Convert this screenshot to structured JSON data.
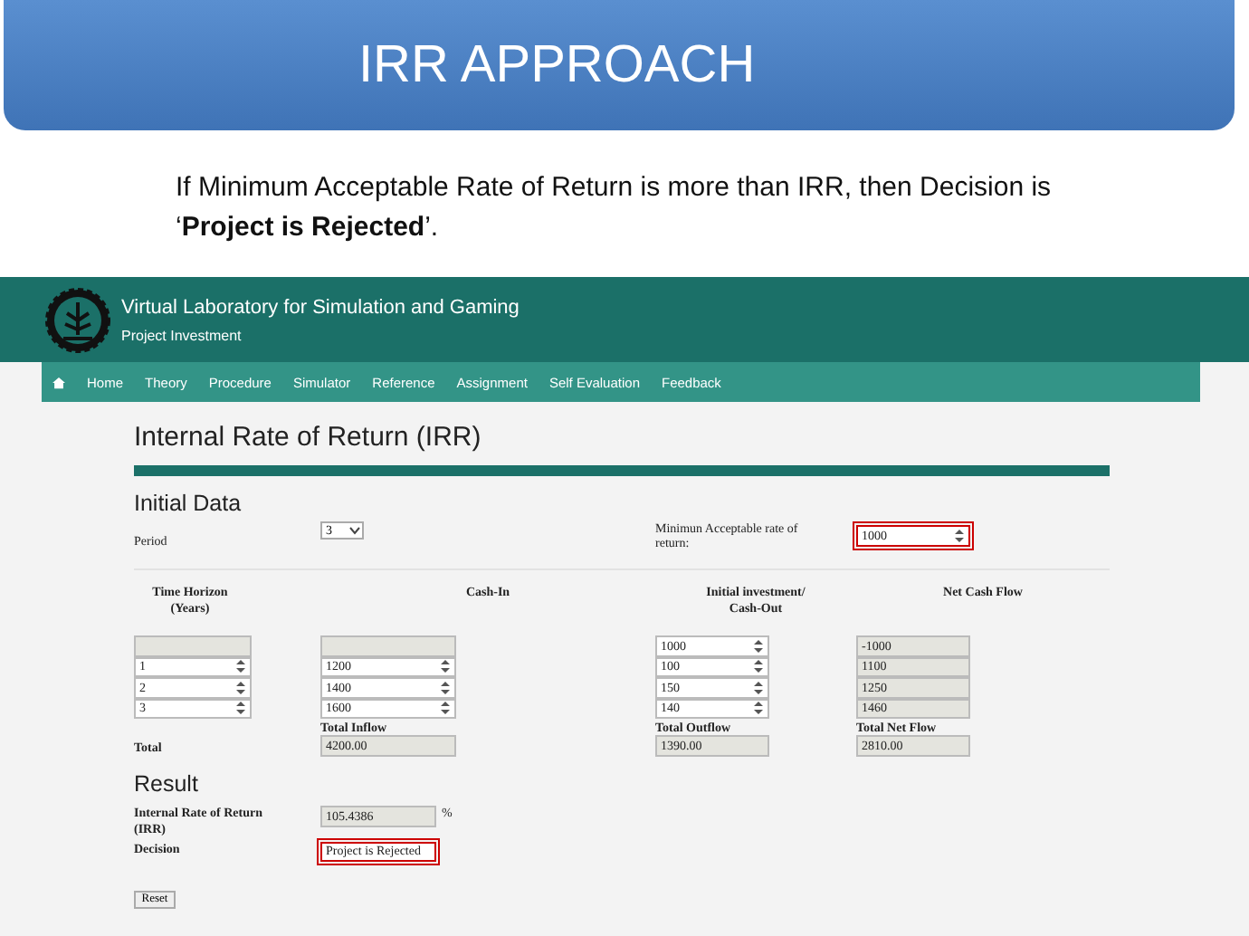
{
  "slide": {
    "title": "IRR APPROACH",
    "note": "If Minimum Acceptable Rate of Return is more than IRR, then Decision  is\n‘**Project is Rejected**’."
  },
  "site": {
    "title": "Virtual Laboratory for Simulation and Gaming",
    "subtitle": "Project Investment",
    "nav": [
      {
        "label": "Home"
      },
      {
        "label": "Theory"
      },
      {
        "label": "Procedure"
      },
      {
        "label": "Simulator"
      },
      {
        "label": "Reference"
      },
      {
        "label": "Assignment"
      },
      {
        "label": "Self Evaluation"
      },
      {
        "label": "Feedback"
      }
    ]
  },
  "page": {
    "heading": "Internal Rate of Return (IRR)",
    "initial_title": "Initial Data",
    "period": {
      "label": "Period",
      "value": "3"
    },
    "mar": {
      "label": "Minimun Acceptable rate of return:",
      "value": "1000",
      "highlighted": true
    },
    "columns": [
      {
        "heading": "Time Horizon (Years)",
        "cells": [
          {
            "kind": "blank"
          },
          {
            "kind": "spin",
            "value": "1"
          },
          {
            "kind": "spin",
            "value": "2"
          },
          {
            "kind": "spin",
            "value": "3"
          }
        ],
        "total_label": "Total"
      },
      {
        "heading": "Cash-In",
        "cells": [
          {
            "kind": "blank"
          },
          {
            "kind": "spin",
            "value": "1200"
          },
          {
            "kind": "spin",
            "value": "1400"
          },
          {
            "kind": "spin",
            "value": "1600"
          }
        ],
        "total_label": "Total Inflow",
        "total": "4200.00"
      },
      {
        "heading": "Initial investment/ Cash-Out",
        "cells": [
          {
            "kind": "spin",
            "value": "1000"
          },
          {
            "kind": "spin",
            "value": "100"
          },
          {
            "kind": "spin",
            "value": "150"
          },
          {
            "kind": "spin",
            "value": "140"
          }
        ],
        "total_label": "Total Outflow",
        "total": "1390.00"
      },
      {
        "heading": "Net Cash Flow",
        "cells": [
          {
            "kind": "readonly",
            "value": "-1000"
          },
          {
            "kind": "readonly",
            "value": "1100"
          },
          {
            "kind": "readonly",
            "value": "1250"
          },
          {
            "kind": "readonly",
            "value": "1460"
          }
        ],
        "total_label": "Total Net Flow",
        "total": "2810.00"
      }
    ],
    "result_title": "Result",
    "results": [
      {
        "label": "Internal Rate of Return (IRR)",
        "value": "105.4386",
        "unit": "%",
        "highlighted": false
      },
      {
        "label": "Decision",
        "value": "Project is Rejected",
        "highlighted": true
      }
    ],
    "reset": "Reset"
  }
}
